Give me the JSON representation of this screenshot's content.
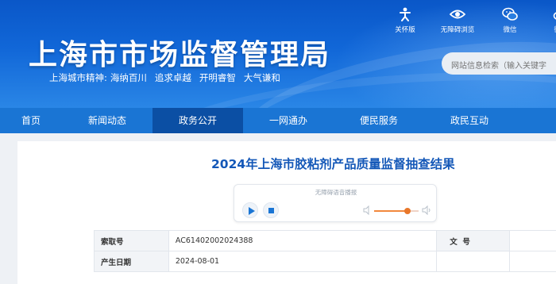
{
  "header": {
    "title": "上海市市场监督管理局",
    "slogan_prefix": "上海城市精神:",
    "slogan_items": [
      "海纳百川",
      "追求卓越",
      "开明睿智",
      "大气谦和"
    ],
    "tools": [
      {
        "label": "关怀版",
        "icon": "accessibility-icon"
      },
      {
        "label": "无障碍浏览",
        "icon": "eye-icon"
      },
      {
        "label": "微信",
        "icon": "wechat-icon"
      },
      {
        "label": "微博",
        "icon": "weibo-icon"
      }
    ],
    "search_placeholder": "网站信息检索（输入关键字"
  },
  "nav": {
    "items": [
      "首页",
      "新闻动态",
      "政务公开",
      "一网通办",
      "便民服务",
      "政民互动"
    ],
    "active": "政务公开"
  },
  "article": {
    "title": "2024年上海市胶粘剂产品质量监督抽查结果"
  },
  "player": {
    "label": "无障碍语音播报",
    "volume_percent": 75
  },
  "meta": {
    "rows": [
      {
        "key": "索取号",
        "value": "AC61402002024388",
        "key2": "文  号",
        "value2": ""
      },
      {
        "key": "产生日期",
        "value": "2024-08-01",
        "key2": "",
        "value2": ""
      }
    ]
  },
  "colors": {
    "header_blue": "#0a57c8",
    "nav_blue": "#1a75d4",
    "nav_active": "#0b4fa4",
    "title_blue": "#1458b8",
    "volume_orange": "#f2883d"
  }
}
